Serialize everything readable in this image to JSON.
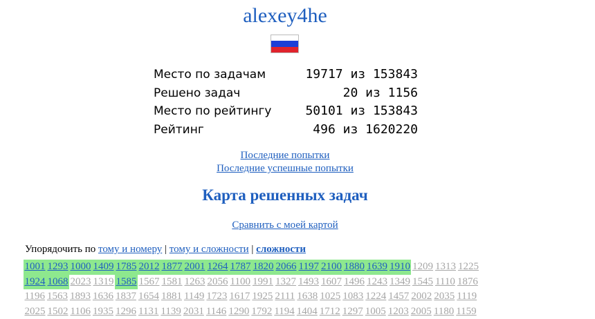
{
  "username": "alexey4he",
  "flag": {
    "colors": [
      "#ffffff",
      "#1c3fd6",
      "#e0232c"
    ],
    "name": "russia-flag"
  },
  "stats": [
    {
      "label": "Место по задачам",
      "value": "19717 из 153843"
    },
    {
      "label": "Решено задач",
      "value": "20 из 1156"
    },
    {
      "label": "Место по рейтингу",
      "value": "50101 из 153843"
    },
    {
      "label": "Рейтинг",
      "value": "496 из 1620220"
    }
  ],
  "links": {
    "last_attempts": "Последние попытки",
    "last_successful": "Последние успешные попытки"
  },
  "map_title": "Карта решенных задач",
  "compare_link": "Сравнить с моей картой",
  "sort": {
    "prefix": "Упорядочить по",
    "by_volume_number": "тому и номеру",
    "sep1": "|",
    "by_volume_difficulty": "тому и сложности",
    "sep2": "|",
    "by_difficulty": "сложности"
  },
  "problem_rows": [
    [
      {
        "id": "1001",
        "solved": true
      },
      {
        "id": "1293",
        "solved": true
      },
      {
        "id": "1000",
        "solved": true
      },
      {
        "id": "1409",
        "solved": true
      },
      {
        "id": "1785",
        "solved": true
      },
      {
        "id": "2012",
        "solved": true
      },
      {
        "id": "1877",
        "solved": true
      },
      {
        "id": "2001",
        "solved": true
      },
      {
        "id": "1264",
        "solved": true
      },
      {
        "id": "1787",
        "solved": true
      },
      {
        "id": "1820",
        "solved": true
      },
      {
        "id": "2066",
        "solved": true
      },
      {
        "id": "1197",
        "solved": true
      },
      {
        "id": "2100",
        "solved": true
      },
      {
        "id": "1880",
        "solved": true
      },
      {
        "id": "1639",
        "solved": true
      },
      {
        "id": "1910",
        "solved": true
      },
      {
        "id": "1209",
        "solved": false
      },
      {
        "id": "1313",
        "solved": false
      },
      {
        "id": "1225",
        "solved": false
      }
    ],
    [
      {
        "id": "1924",
        "solved": true
      },
      {
        "id": "1068",
        "solved": true
      },
      {
        "id": "2023",
        "solved": false
      },
      {
        "id": "1319",
        "solved": false
      },
      {
        "id": "1585",
        "solved": true
      },
      {
        "id": "1567",
        "solved": false
      },
      {
        "id": "1581",
        "solved": false
      },
      {
        "id": "1263",
        "solved": false
      },
      {
        "id": "2056",
        "solved": false
      },
      {
        "id": "1100",
        "solved": false
      },
      {
        "id": "1991",
        "solved": false
      },
      {
        "id": "1327",
        "solved": false
      },
      {
        "id": "1493",
        "solved": false
      },
      {
        "id": "1607",
        "solved": false
      },
      {
        "id": "1496",
        "solved": false
      },
      {
        "id": "1243",
        "solved": false
      },
      {
        "id": "1349",
        "solved": false
      },
      {
        "id": "1545",
        "solved": false
      },
      {
        "id": "1110",
        "solved": false
      },
      {
        "id": "1876",
        "solved": false
      }
    ],
    [
      {
        "id": "1196",
        "solved": false
      },
      {
        "id": "1563",
        "solved": false
      },
      {
        "id": "1893",
        "solved": false
      },
      {
        "id": "1636",
        "solved": false
      },
      {
        "id": "1837",
        "solved": false
      },
      {
        "id": "1654",
        "solved": false
      },
      {
        "id": "1881",
        "solved": false
      },
      {
        "id": "1149",
        "solved": false
      },
      {
        "id": "1723",
        "solved": false
      },
      {
        "id": "1617",
        "solved": false
      },
      {
        "id": "1925",
        "solved": false
      },
      {
        "id": "2111",
        "solved": false
      },
      {
        "id": "1638",
        "solved": false
      },
      {
        "id": "1025",
        "solved": false
      },
      {
        "id": "1083",
        "solved": false
      },
      {
        "id": "1224",
        "solved": false
      },
      {
        "id": "1457",
        "solved": false
      },
      {
        "id": "2002",
        "solved": false
      },
      {
        "id": "2035",
        "solved": false
      },
      {
        "id": "1119",
        "solved": false
      }
    ],
    [
      {
        "id": "2025",
        "solved": false
      },
      {
        "id": "1502",
        "solved": false
      },
      {
        "id": "1106",
        "solved": false
      },
      {
        "id": "1935",
        "solved": false
      },
      {
        "id": "1296",
        "solved": false
      },
      {
        "id": "1131",
        "solved": false
      },
      {
        "id": "1139",
        "solved": false
      },
      {
        "id": "2031",
        "solved": false
      },
      {
        "id": "1146",
        "solved": false
      },
      {
        "id": "1290",
        "solved": false
      },
      {
        "id": "1792",
        "solved": false
      },
      {
        "id": "1194",
        "solved": false
      },
      {
        "id": "1404",
        "solved": false
      },
      {
        "id": "1712",
        "solved": false
      },
      {
        "id": "1297",
        "solved": false
      },
      {
        "id": "1005",
        "solved": false
      },
      {
        "id": "1203",
        "solved": false
      },
      {
        "id": "2005",
        "solved": false
      },
      {
        "id": "1180",
        "solved": false
      },
      {
        "id": "1159",
        "solved": false
      }
    ]
  ]
}
